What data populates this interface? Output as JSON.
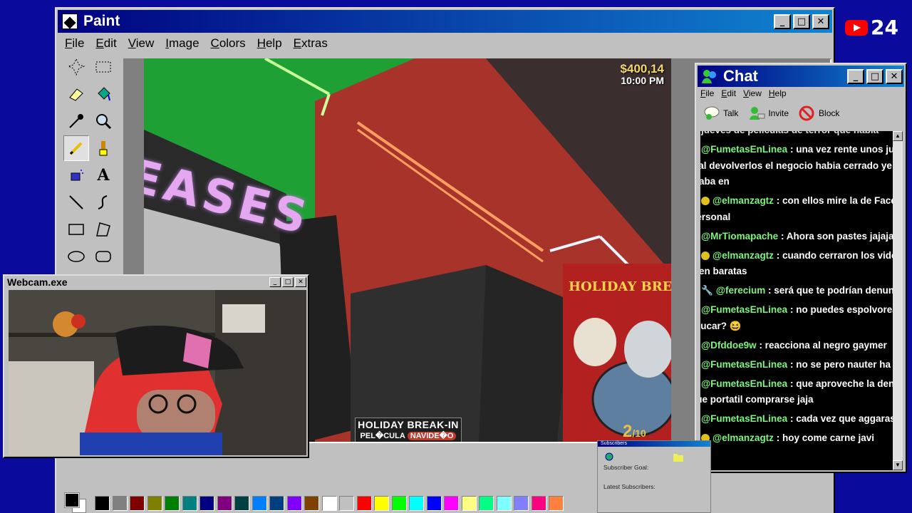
{
  "paint": {
    "title": "Paint",
    "menu": [
      "File",
      "Edit",
      "View",
      "Image",
      "Colors",
      "Help",
      "Extras"
    ],
    "palette": [
      "#000000",
      "#808080",
      "#800000",
      "#808000",
      "#008000",
      "#008080",
      "#000080",
      "#800080",
      "#004040",
      "#0080ff",
      "#004080",
      "#8000ff",
      "#804000",
      "#ffffff",
      "#c0c0c0",
      "#ff0000",
      "#ffff00",
      "#00ff00",
      "#00ffff",
      "#0000ff",
      "#ff00ff",
      "#ffff80",
      "#00ff80",
      "#80ffff",
      "#8080ff",
      "#ff0080",
      "#ff8040"
    ]
  },
  "game": {
    "money": "$400,14",
    "time": "10:00 PM",
    "sign": "EASES",
    "tag_title": "HOLIDAY BREAK-IN",
    "tag_word1": "PEL�CULA",
    "tag_word2": "NAVIDE�O",
    "poster_title": "HOLIDAY BREA",
    "poster_num": "2",
    "poster_den": "/10"
  },
  "webcam": {
    "title": "Webcam.exe"
  },
  "chat": {
    "title": "Chat",
    "menu": [
      "File",
      "Edit",
      "View",
      "Help"
    ],
    "tools": [
      "Talk",
      "Invite",
      "Block"
    ],
    "partial_line": "... jueves de películas de terror que había",
    "messages": [
      {
        "badge": "bd",
        "user": "@FumetasEnLinea",
        "text": ": una vez rente unos juegos y al devolverlos el negocio habia cerrado ye staba en"
      },
      {
        "badge": "bd-star",
        "user": "@elmanzagtz",
        "text": ": con ellos mire la de Face off personal"
      },
      {
        "badge": "bd",
        "user": "@MrTiomapache",
        "text": ": Ahora son pastes jajaja"
      },
      {
        "badge": "bd-star",
        "user": "@elmanzagtz",
        "text": ": cuando cerraron los videos bien baratas"
      },
      {
        "badge": "bd-tool",
        "user": "@ferecium",
        "text": ": será que te podrían denunciar"
      },
      {
        "badge": "bd",
        "user": "@FumetasEnLinea",
        "text": ": no puedes espolvorear de azucar? 😆"
      },
      {
        "badge": "bd",
        "user": "@Dfddoe9w",
        "text": ": reacciona al negro gaymer"
      },
      {
        "badge": "bd",
        "user": "@FumetasEnLinea",
        "text": ": no se pero nauter ha sa"
      },
      {
        "badge": "bd",
        "user": "@FumetasEnLinea",
        "text": ": que aproveche la denun que portatil comprarse jaja"
      },
      {
        "badge": "bd",
        "user": "@FumetasEnLinea",
        "text": ": cada vez que aggaras la"
      },
      {
        "badge": "bd-star",
        "user": "@elmanzagtz",
        "text": ": hoy come carne javi"
      }
    ]
  },
  "subscribers": {
    "title": "Subscribers",
    "goal": "Subscriber Goal:",
    "latest": "Latest Subscribers:"
  },
  "youtube": {
    "count": "24"
  }
}
